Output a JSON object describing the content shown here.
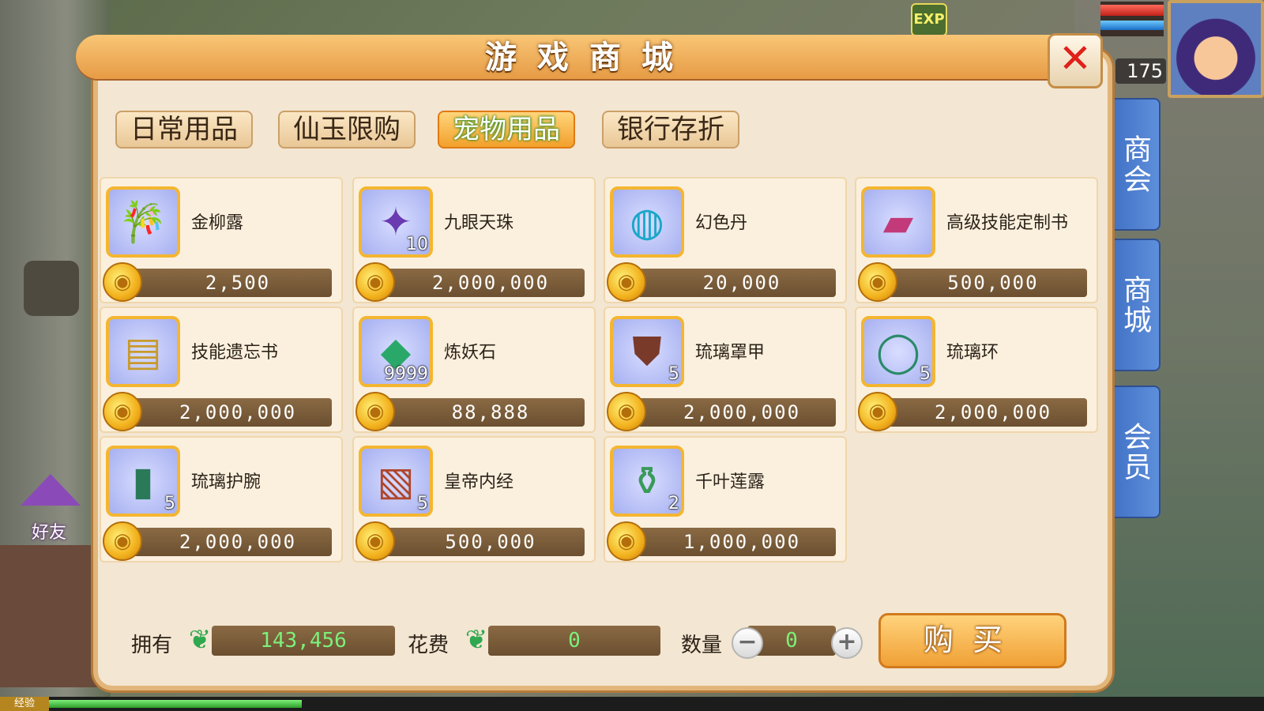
{
  "hud": {
    "exp_badge": "EXP",
    "level": "175"
  },
  "side_tabs": [
    "商会",
    "商城",
    "会员"
  ],
  "friend": {
    "label": "好友"
  },
  "exp_bar": {
    "label": "经验",
    "progress": 0.2
  },
  "panel": {
    "title": "游戏商城"
  },
  "tabs": [
    {
      "label": "日常用品",
      "active": false
    },
    {
      "label": "仙玉限购",
      "active": false
    },
    {
      "label": "宠物用品",
      "active": true
    },
    {
      "label": "银行存折",
      "active": false
    }
  ],
  "items": [
    {
      "name": "金柳露",
      "price": "2,500",
      "count": "",
      "icon": "bamboo-vase-icon"
    },
    {
      "name": "九眼天珠",
      "price": "2,000,000",
      "count": "10",
      "icon": "purple-bead-icon"
    },
    {
      "name": "幻色丹",
      "price": "20,000",
      "count": "",
      "icon": "cyan-orb-icon"
    },
    {
      "name": "高级技能定制书",
      "price": "500,000",
      "count": "",
      "icon": "pink-book-icon"
    },
    {
      "name": "技能遗忘书",
      "price": "2,000,000",
      "count": "",
      "icon": "yellow-book-icon"
    },
    {
      "name": "炼妖石",
      "price": "88,888",
      "count": "9999",
      "icon": "green-crystal-icon"
    },
    {
      "name": "琉璃罩甲",
      "price": "2,000,000",
      "count": "5",
      "icon": "armor-icon"
    },
    {
      "name": "琉璃环",
      "price": "2,000,000",
      "count": "5",
      "icon": "jade-ring-icon"
    },
    {
      "name": "琉璃护腕",
      "price": "2,000,000",
      "count": "5",
      "icon": "bracer-icon"
    },
    {
      "name": "皇帝内经",
      "price": "500,000",
      "count": "5",
      "icon": "scroll-icon"
    },
    {
      "name": "千叶莲露",
      "price": "1,000,000",
      "count": "2",
      "icon": "lotus-vase-icon"
    }
  ],
  "footer": {
    "owned_label": "拥有",
    "owned_value": "143,456",
    "cost_label": "花费",
    "cost_value": "0",
    "quantity_label": "数量",
    "quantity_value": "0",
    "buy_label": "购买"
  },
  "colors": {
    "accent": "#f2a02c",
    "panel": "#f3e6d2",
    "price_text": "#7cf07a"
  }
}
